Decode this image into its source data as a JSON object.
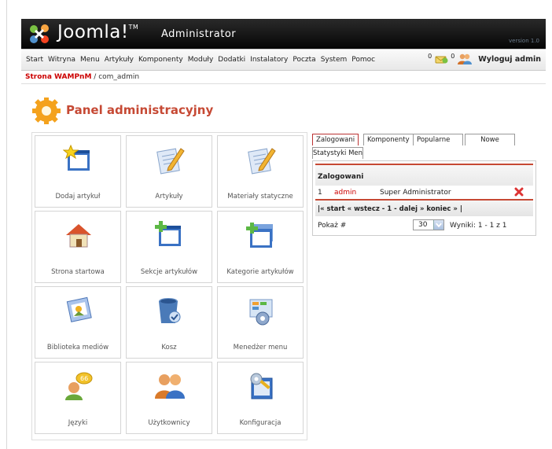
{
  "header": {
    "logo": "Joomla!",
    "logo_tm": "TM",
    "subtitle": "Administrator",
    "version": "version 1.0"
  },
  "menu": {
    "items": [
      "Start",
      "Witryna",
      "Menu",
      "Artykuły",
      "Komponenty",
      "Moduły",
      "Dodatki",
      "Instalatory",
      "Poczta",
      "System",
      "Pomoc"
    ],
    "messages_count": "0",
    "users_count": "0",
    "logout": "Wyloguj admin"
  },
  "breadcrumb": {
    "site": "Strona WAMPnM",
    "path": " / com_admin"
  },
  "page": {
    "title": "Panel administracyjny"
  },
  "tiles": [
    {
      "label": "Dodaj artykuł",
      "icon": "new-article-icon"
    },
    {
      "label": "Artykuły",
      "icon": "articles-icon"
    },
    {
      "label": "Materiały statyczne",
      "icon": "static-content-icon"
    },
    {
      "label": "Strona startowa",
      "icon": "frontpage-icon"
    },
    {
      "label": "Sekcje artykułów",
      "icon": "sections-icon"
    },
    {
      "label": "Kategorie artykułów",
      "icon": "categories-icon"
    },
    {
      "label": "Biblioteka mediów",
      "icon": "media-icon"
    },
    {
      "label": "Kosz",
      "icon": "trash-icon"
    },
    {
      "label": "Menedżer menu",
      "icon": "menu-manager-icon"
    },
    {
      "label": "Języki",
      "icon": "languages-icon"
    },
    {
      "label": "Użytkownicy",
      "icon": "users-icon"
    },
    {
      "label": "Konfiguracja",
      "icon": "config-icon"
    }
  ],
  "tabs": {
    "items": [
      "Zalogowani",
      "Komponenty",
      "Popularne",
      "Nowe"
    ],
    "second_row": "Statystyki Men",
    "active": "Zalogowani"
  },
  "logged_panel": {
    "heading": "Zalogowani",
    "rows": [
      {
        "num": "1",
        "user": "admin",
        "group": "Super Administrator"
      }
    ],
    "pagination": "|« start « wstecz - 1 - dalej » koniec » |",
    "show_label": "Pokaż #",
    "limit": "30",
    "results": "Wyniki: 1 - 1 z 1"
  }
}
